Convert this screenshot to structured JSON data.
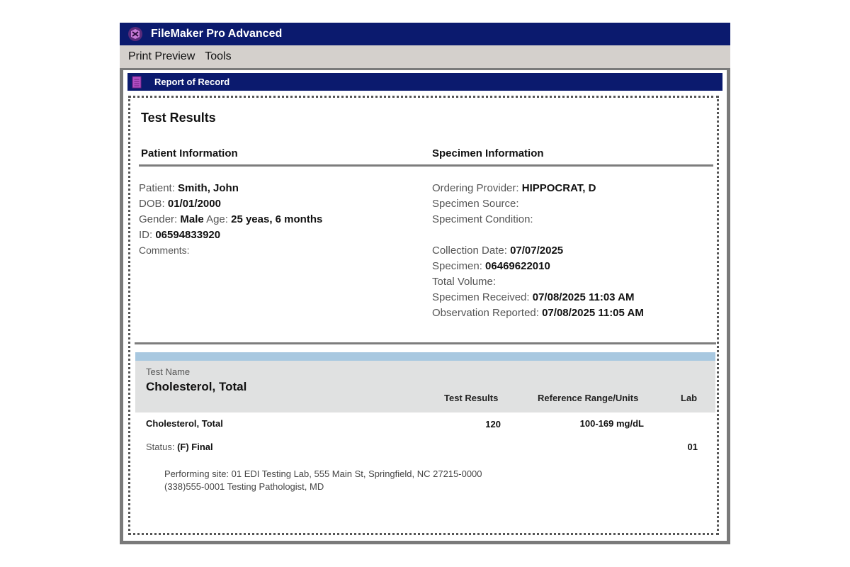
{
  "window": {
    "title": "FileMaker Pro Advanced",
    "app_icon": "filemaker-icon",
    "menu": [
      "Print Preview",
      "Tools"
    ]
  },
  "document": {
    "title": "Report of Record",
    "icon": "document-icon"
  },
  "report": {
    "heading": "Test Results",
    "patient": {
      "section_title": "Patient Information",
      "patient_label": "Patient:",
      "patient_value": "Smith, John",
      "dob_label": "DOB:",
      "dob_value": "01/01/2000",
      "gender_label": "Gender:",
      "gender_value": "Male",
      "age_label": "Age:",
      "age_value": "25 yeas, 6 months",
      "id_label": "ID:",
      "id_value": "06594833920",
      "comments_label": "Comments:"
    },
    "specimen": {
      "section_title": "Specimen Information",
      "provider_label": "Ordering Provider:",
      "provider_value": "HIPPOCRAT, D",
      "source_label": "Specimen Source:",
      "condition_label": "Speciment Condition:",
      "collection_label": "Collection Date:",
      "collection_value": "07/07/2025",
      "specimen_label": "Specimen:",
      "specimen_value": "06469622010",
      "volume_label": "Total Volume:",
      "received_label": "Specimen Received:",
      "received_value": "07/08/2025 11:03 AM",
      "reported_label": "Observation Reported:",
      "reported_value": "07/08/2025 11:05 AM"
    },
    "test": {
      "name_caption": "Test Name",
      "name": "Cholesterol, Total",
      "columns": {
        "results": "Test Results",
        "range": "Reference Range/Units",
        "lab": "Lab"
      },
      "row": {
        "name": "Cholesterol, Total",
        "result": "120",
        "range": "100-169 mg/dL",
        "lab": "01"
      },
      "status_label": "Status:",
      "status_value": "(F) Final",
      "performing_line1": "Performing site: 01 EDI Testing Lab, 555  Main St, Springfield, NC 27215-0000",
      "performing_line2": "(338)555-0001 Testing Pathologist, MD"
    }
  }
}
